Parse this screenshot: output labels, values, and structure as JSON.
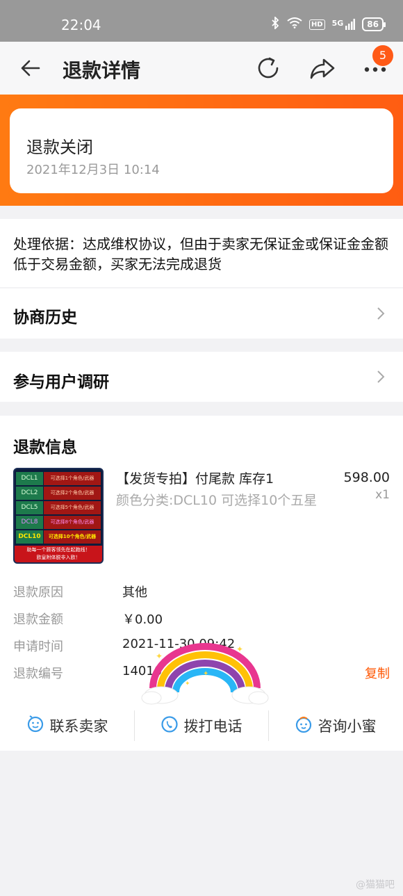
{
  "status_bar": {
    "time": "22:04",
    "hd_label": "HD",
    "network_label": "5G",
    "battery": "86"
  },
  "nav": {
    "title": "退款详情",
    "badge_count": "5"
  },
  "refund_status": {
    "title": "退款关闭",
    "date": "2021年12月3日 10:14"
  },
  "basis_text": "处理依据：达成维权协议，但由于卖家无保证金或保证金金额低于交易金额，买家无法完成退货",
  "rows": {
    "history": "协商历史",
    "survey": "参与用户调研"
  },
  "refund_info": {
    "section_title": "退款信息",
    "product": {
      "title": "【发货专拍】付尾款 库存1",
      "spec": "颜色分类:DCL10 可选择10个五星",
      "price": "598.00",
      "qty": "x1",
      "thumb_rows": [
        {
          "code": "DCL1",
          "desc": "可选择1个角色/武器"
        },
        {
          "code": "DCL2",
          "desc": "可选择2个角色/武器"
        },
        {
          "code": "DCL5",
          "desc": "可选择5个角色/武器"
        },
        {
          "code": "DCL8",
          "desc": "可选择8个角色/武器"
        },
        {
          "code": "DCL10",
          "desc": "可选择10个角色/武器"
        }
      ],
      "thumb_footer_1": "助每一个顾客领先在起跑线！",
      "thumb_footer_2": "欧皇附体脱非入欧！"
    },
    "fields": [
      {
        "label": "退款原因",
        "value": "其他"
      },
      {
        "label": "退款金额",
        "value": "￥0.00"
      },
      {
        "label": "申请时间",
        "value": "2021-11-30 09:42"
      },
      {
        "label": "退款编号",
        "value": "14010"
      }
    ],
    "copy_label": "复制"
  },
  "actions": {
    "contact_seller": "联系卖家",
    "call_phone": "拨打电话",
    "consult": "咨询小蜜"
  },
  "watermark": "@猫猫吧",
  "colors": {
    "accent": "#ff5d12",
    "status_bar": "#999999",
    "icon_blue": "#3a9be8"
  }
}
